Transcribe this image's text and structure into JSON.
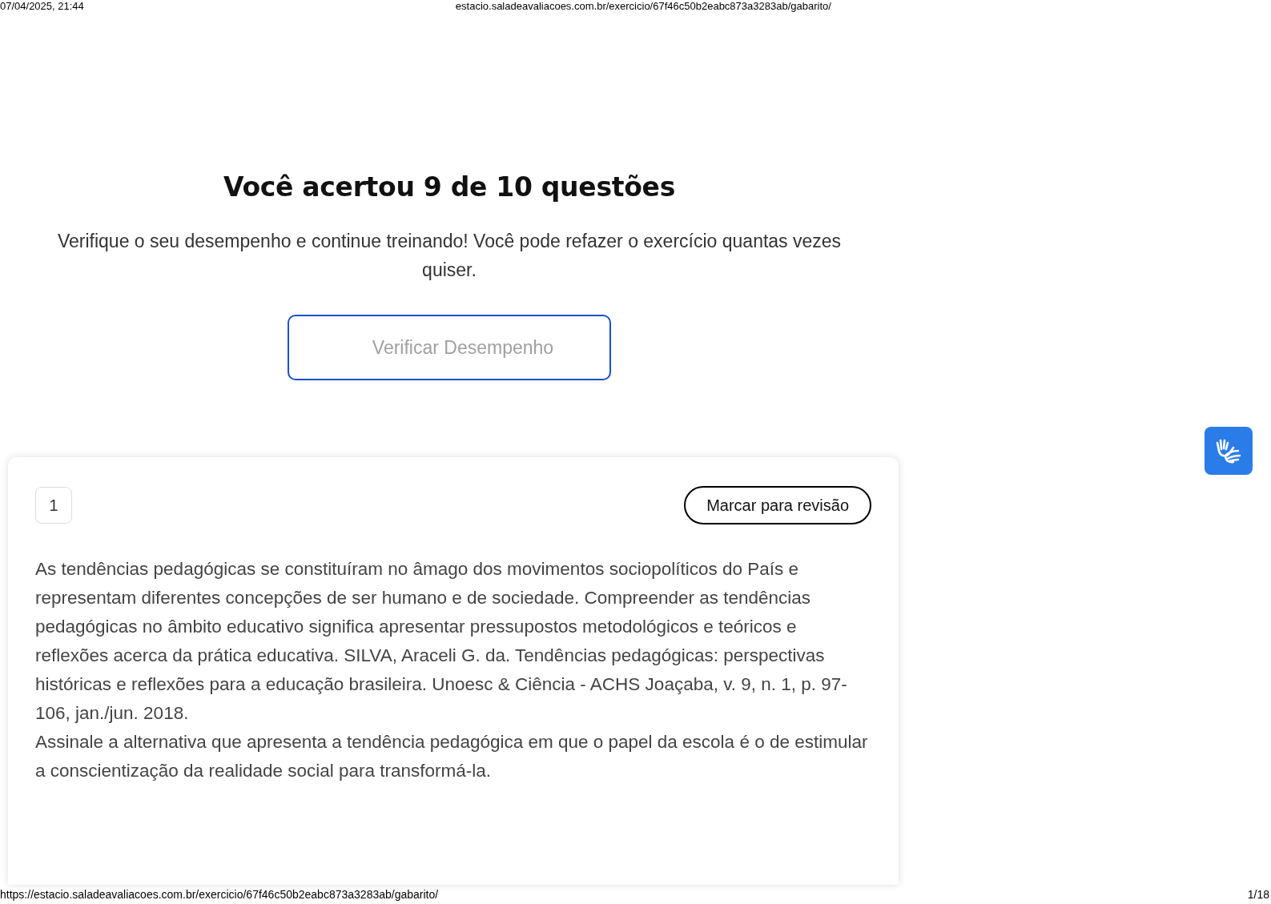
{
  "print_header": {
    "date": "07/04/2025, 21:44",
    "url": "estacio.saladeavaliacoes.com.br/exercicio/67f46c50b2eabc873a3283ab/gabarito/"
  },
  "result": {
    "title": "Você acertou 9 de 10 questões",
    "subtitle": "Verifique o seu desempenho e continue treinando! Você pode refazer o exercício quantas vezes quiser.",
    "button": "Verificar Desempenho"
  },
  "question": {
    "number": "1",
    "review_button": "Marcar para revisão",
    "paragraphs": [
      "As tendências pedagógicas se constituíram no âmago dos movimentos sociopolíticos do País e representam diferentes concepções de ser humano e de sociedade. Compreender as tendências pedagógicas no âmbito educativo significa apresentar pressupostos metodológicos e teóricos e reflexões acerca da prática educativa. SILVA, Araceli G. da. Tendências pedagógicas: perspectivas históricas e reflexões para a educação brasileira. Unoesc & Ciência - ACHS Joaçaba, v. 9, n. 1, p. 97-106, jan./jun. 2018.",
      "Assinale a alternativa que apresenta a tendência pedagógica em que o papel da escola é o de estimular a conscientização da realidade social para transformá-la."
    ]
  },
  "print_footer": {
    "url": "https://estacio.saladeavaliacoes.com.br/exercicio/67f46c50b2eabc873a3283ab/gabarito/",
    "page": "1/18"
  }
}
